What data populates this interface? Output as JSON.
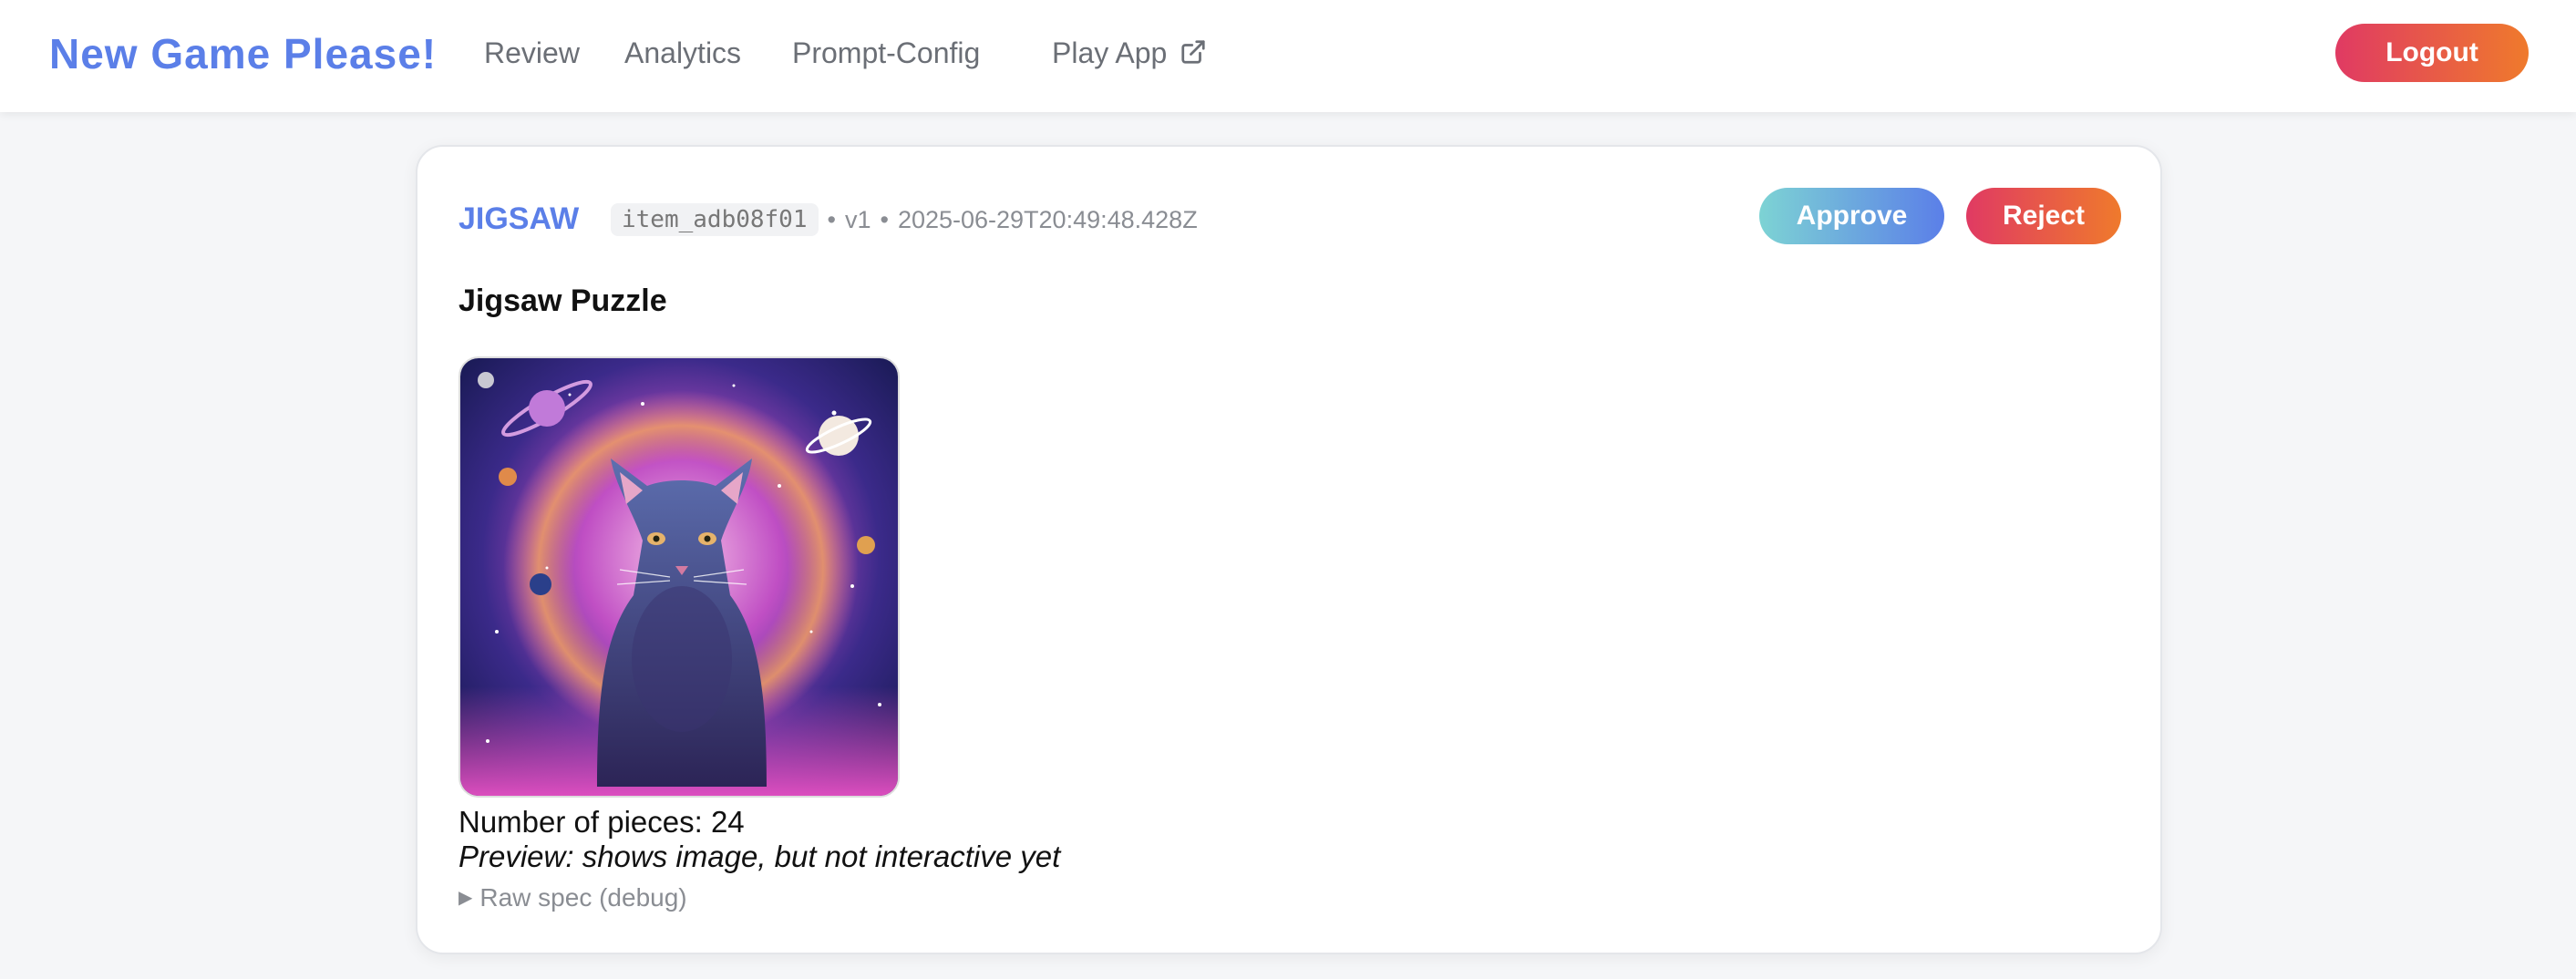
{
  "header": {
    "brand": "New Game Please!",
    "nav": [
      "Review",
      "Analytics",
      "Prompt-Config",
      "Play App"
    ],
    "logout_label": "Logout"
  },
  "item": {
    "type": "JIGSAW",
    "id": "item_adb08f01",
    "meta_separator": "•",
    "version": "v1",
    "timestamp": "2025-06-29T20:49:48.428Z",
    "approve_label": "Approve",
    "reject_label": "Reject",
    "title": "Jigsaw Puzzle",
    "pieces_text": "Number of pieces: 24",
    "preview_note": "Preview: shows image, but not interactive yet",
    "raw_spec_label": "Raw spec (debug)"
  },
  "icons": {
    "external": "external-link-icon",
    "disclosure": "triangle-right-icon"
  },
  "colors": {
    "brand": "#5b7fe8",
    "danger_gradient_start": "#e03a63",
    "danger_gradient_end": "#ef7a2c",
    "approve_gradient_start": "#7dd3d4",
    "approve_gradient_end": "#5b7fe8"
  }
}
